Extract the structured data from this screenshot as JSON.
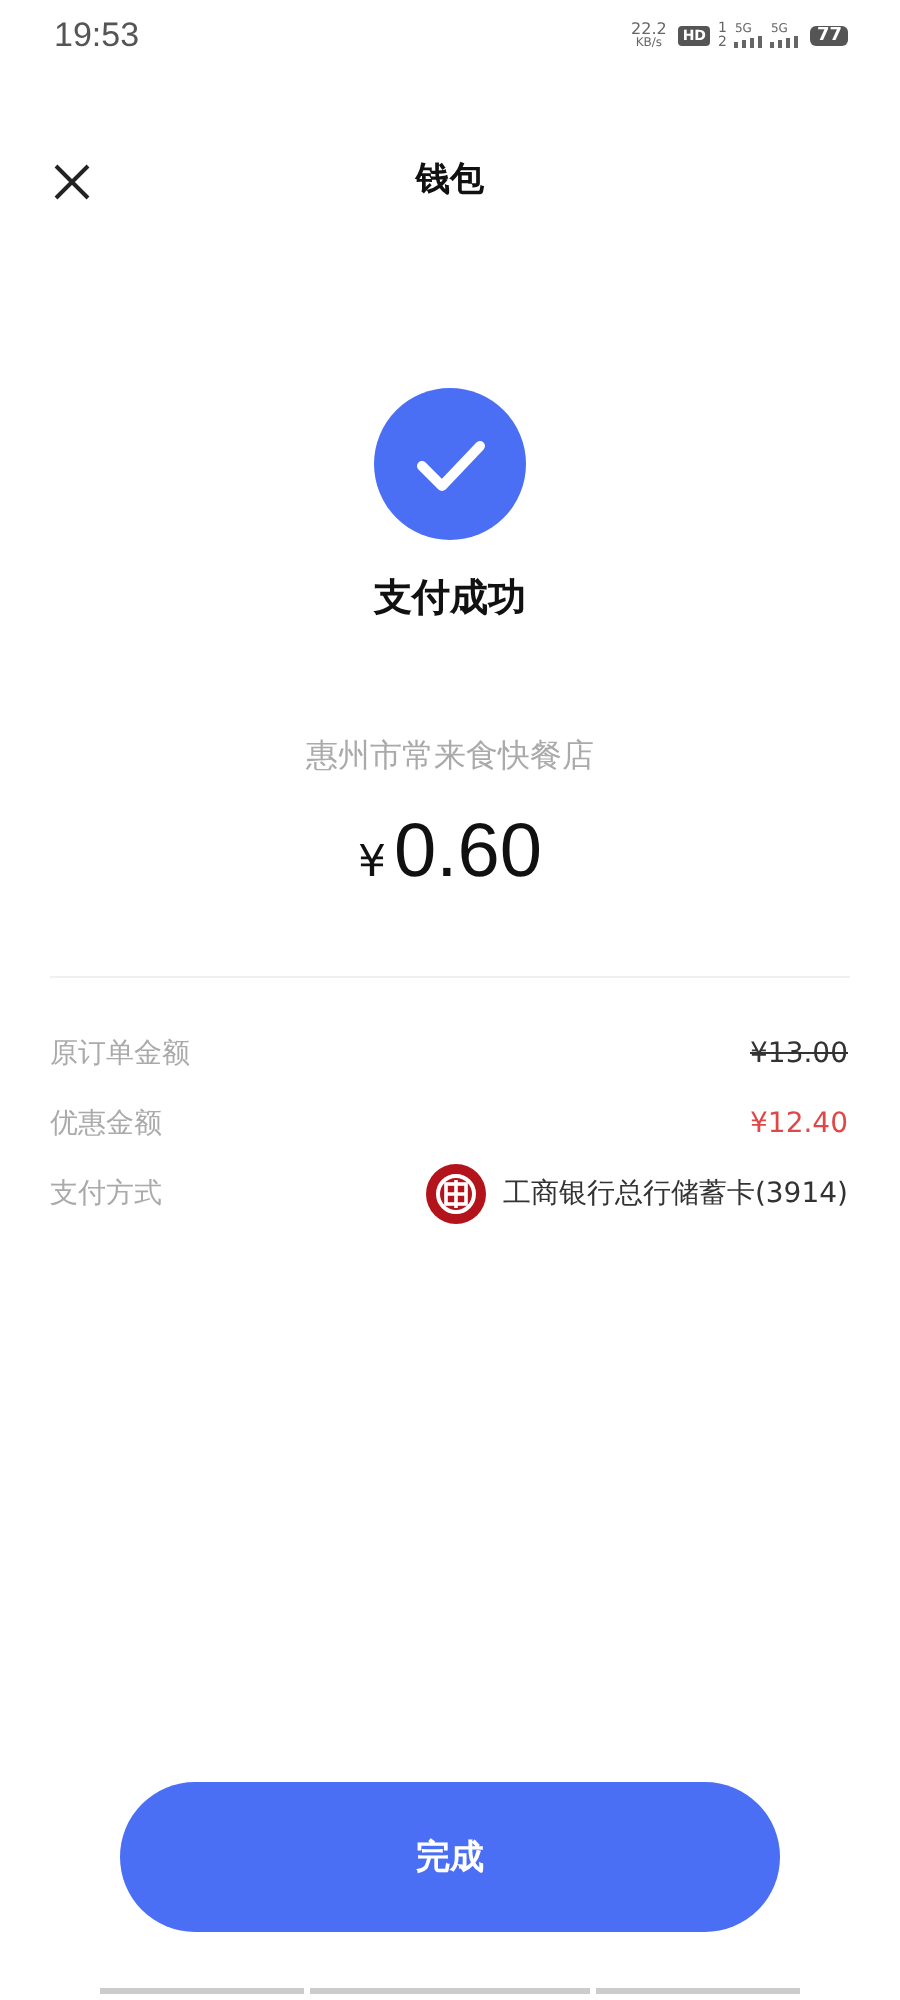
{
  "status_bar": {
    "time": "19:53",
    "net_speed": "22.2",
    "net_unit": "KB/s",
    "hd": "HD",
    "sim_slots": [
      "1",
      "2"
    ],
    "signals": [
      "5G",
      "5G"
    ],
    "battery": "77"
  },
  "header": {
    "title": "钱包"
  },
  "result": {
    "status": "支付成功",
    "merchant": "惠州市常来食快餐店",
    "currency": "¥",
    "amount": "0.60"
  },
  "details": [
    {
      "label": "原订单金额",
      "value": "¥13.00",
      "kind": "struck"
    },
    {
      "label": "优惠金额",
      "value": "¥12.40",
      "kind": "discount"
    },
    {
      "label": "支付方式",
      "value": "工商银行总行储蓄卡(3914)",
      "kind": "bank"
    }
  ],
  "button": {
    "label": "完成"
  }
}
